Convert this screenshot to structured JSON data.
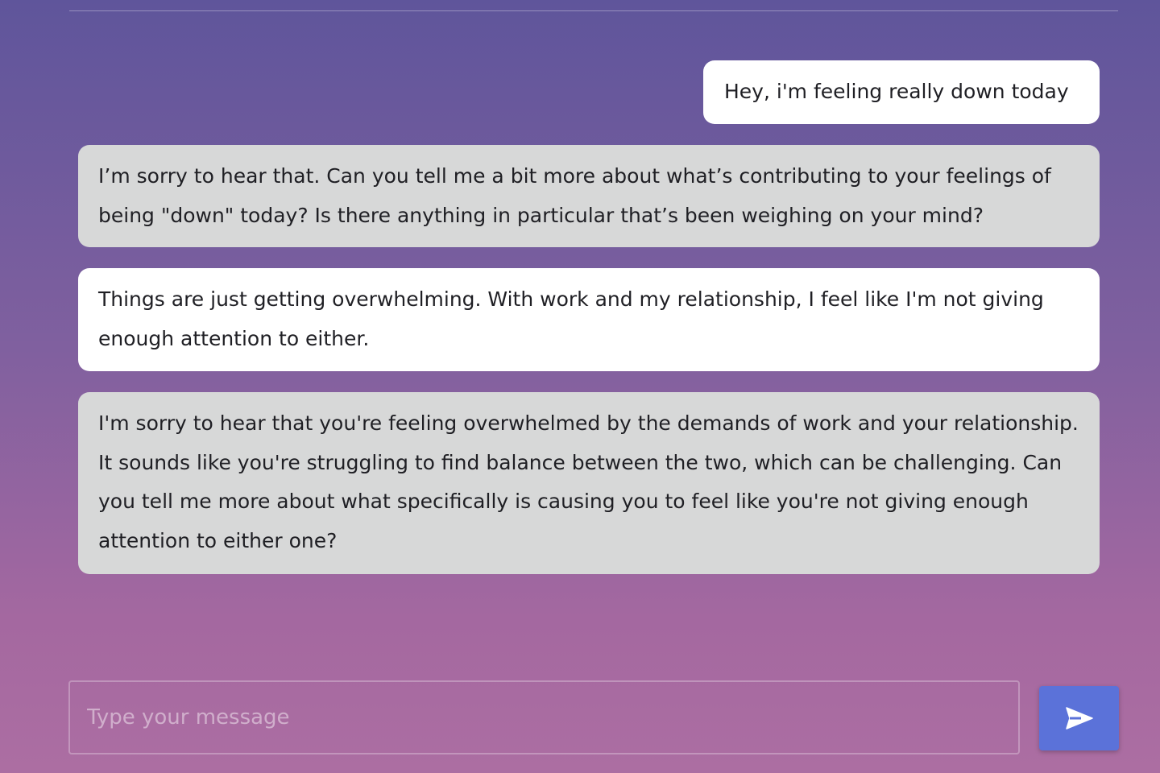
{
  "messages": [
    {
      "role": "user",
      "text": "Hey, i'm feeling really down today"
    },
    {
      "role": "assistant",
      "text": "I’m sorry to hear that. Can you tell me a bit more about what’s contributing to your feelings of being \"down\" today? Is there anything in particular that’s been weighing on your mind?"
    },
    {
      "role": "user",
      "text": "Things are just getting overwhelming. With work and my relationship, I feel like I'm not giving enough attention to either."
    },
    {
      "role": "assistant",
      "text": "I'm sorry to hear that you're feeling overwhelmed by the demands of work and your relationship. It sounds like you're struggling to find balance between the two, which can be challenging. Can you tell me more about what specifically is causing you to feel like you're not giving enough attention to either one?"
    }
  ],
  "composer": {
    "placeholder": "Type your message",
    "value": "",
    "send_icon": "send-arrow-icon"
  },
  "colors": {
    "user_bubble": "#ffffff",
    "assistant_bubble": "#d7d8d8",
    "send_button": "#5b72d9",
    "background_top": "#5f559b",
    "background_bottom": "#ac6ea2"
  }
}
